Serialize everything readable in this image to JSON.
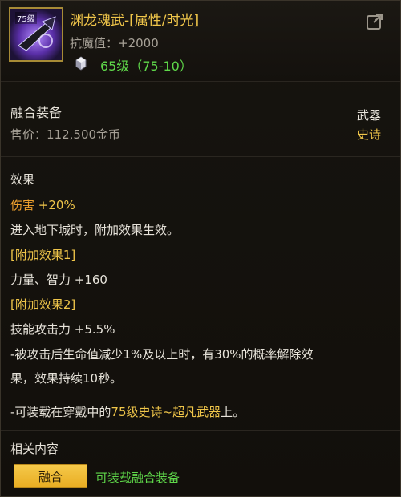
{
  "item": {
    "icon_tag": "75级",
    "name": "渊龙魂武-[属性/时光]",
    "stat_label": "抗魔值：",
    "stat_value": "+2000",
    "level_text": "65级（75-10）",
    "type": "融合装备",
    "price_label": "售价：",
    "price_value": "112,500金币",
    "slot": "武器",
    "rarity": "史诗"
  },
  "effects": {
    "title": "效果",
    "damage_label": "伤害",
    "damage_value": "+20%",
    "dungeon_note": "进入地下城时，附加效果生效。",
    "bonus1_title": "[附加效果1]",
    "bonus1_text": "力量、智力 +160",
    "bonus2_title": "[附加效果2]",
    "bonus2_text": "技能攻击力 +5.5%",
    "dispel_line1": "-被攻击后生命值减少1%及以上时，有30%的概率解除效",
    "dispel_line2": "果，效果持续10秒。",
    "equip_prefix": "-可装载在穿戴中的",
    "equip_highlight": "75级史诗~超凡武器",
    "equip_suffix": "上。"
  },
  "related": {
    "title": "相关内容",
    "button_label": "融合",
    "button_desc": "可装载融合装备"
  },
  "colors": {
    "gold": "#f0c64a",
    "orange": "#f0a22e",
    "green": "#5fd84a",
    "grey": "#a7a197"
  },
  "icons": [
    "weapon-icon",
    "gem-icon",
    "share-icon"
  ]
}
